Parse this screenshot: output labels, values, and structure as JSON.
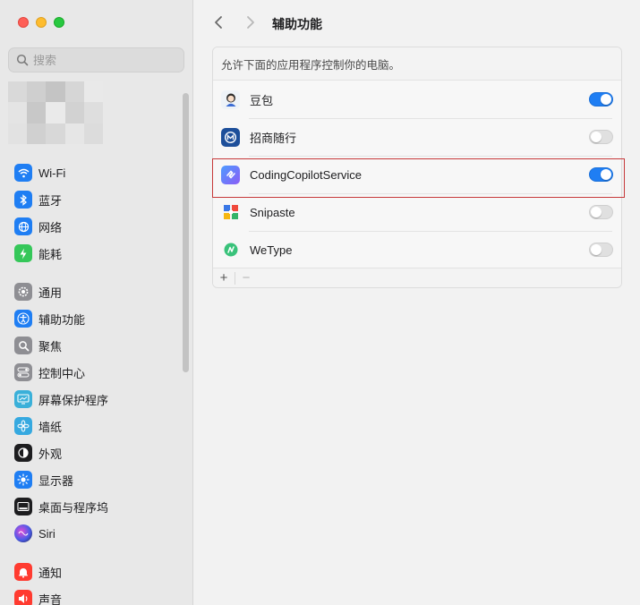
{
  "sidebar": {
    "search_placeholder": "搜索",
    "groups": [
      [
        {
          "label": "Wi-Fi",
          "icon": "wifi-icon",
          "color": "#1f7ef3"
        },
        {
          "label": "蓝牙",
          "icon": "bluetooth-icon",
          "color": "#1f7ef3"
        },
        {
          "label": "网络",
          "icon": "globe-icon",
          "color": "#1f7ef3"
        },
        {
          "label": "能耗",
          "icon": "battery-bolt-icon",
          "color": "#35c759"
        }
      ],
      [
        {
          "label": "通用",
          "icon": "gear-icon",
          "color": "#8e8e93"
        },
        {
          "label": "辅助功能",
          "icon": "accessibility-icon",
          "color": "#1f7ef3"
        },
        {
          "label": "聚焦",
          "icon": "spotlight-icon",
          "color": "#8e8e93"
        },
        {
          "label": "控制中心",
          "icon": "control-center-icon",
          "color": "#8e8e93"
        },
        {
          "label": "屏幕保护程序",
          "icon": "screensaver-icon",
          "color": "#3ab0d9"
        },
        {
          "label": "墙纸",
          "icon": "wallpaper-icon",
          "color": "#36a9e0"
        },
        {
          "label": "外观",
          "icon": "appearance-icon",
          "color": "#1d1d1f"
        },
        {
          "label": "显示器",
          "icon": "display-icon",
          "color": "#1f7ef3"
        },
        {
          "label": "桌面与程序坞",
          "icon": "dock-icon",
          "color": "#1d1d1f"
        },
        {
          "label": "Siri",
          "icon": "siri-icon",
          "color": "#6b3fb8"
        }
      ],
      [
        {
          "label": "通知",
          "icon": "bell-icon",
          "color": "#ff3b30"
        },
        {
          "label": "声音",
          "icon": "speaker-icon",
          "color": "#ff3b30"
        }
      ]
    ]
  },
  "main": {
    "title": "辅助功能",
    "description": "允许下面的应用程序控制你的电脑。",
    "apps": [
      {
        "name": "豆包",
        "icon": "doubao-icon",
        "enabled": true
      },
      {
        "name": "招商随行",
        "icon": "zhaoshang-icon",
        "enabled": false
      },
      {
        "name": "CodingCopilotService",
        "icon": "coding-copilot-icon",
        "enabled": true
      },
      {
        "name": "Snipaste",
        "icon": "snipaste-icon",
        "enabled": false
      },
      {
        "name": "WeType",
        "icon": "wetype-icon",
        "enabled": false
      }
    ],
    "add_label": "+",
    "remove_label": "−"
  },
  "colors": {
    "accent": "#1f7ef3",
    "highlight_border": "#c7393a"
  }
}
